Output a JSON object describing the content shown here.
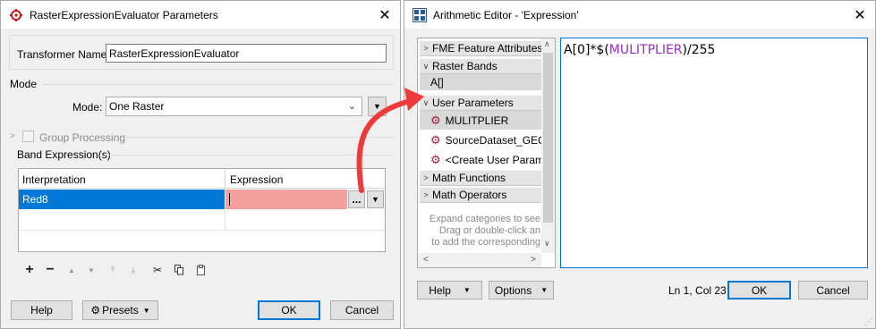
{
  "left_dialog": {
    "title": "RasterExpressionEvaluator Parameters",
    "transformer_name_label": "Transformer Name:",
    "transformer_name_value": "RasterExpressionEvaluator",
    "mode_section": "Mode",
    "mode_label": "Mode:",
    "mode_value": "One Raster",
    "group_processing_label": "Group Processing",
    "band_expressions_section": "Band Expression(s)",
    "table": {
      "columns": [
        "Interpretation",
        "Expression"
      ],
      "rows": [
        {
          "interpretation": "Red8",
          "expression": ""
        }
      ]
    },
    "ellipsis_label": "...",
    "buttons": {
      "help": "Help",
      "presets": "Presets",
      "ok": "OK",
      "cancel": "Cancel"
    }
  },
  "right_dialog": {
    "title": "Arithmetic Editor - 'Expression'",
    "categories": {
      "fme_feature_attributes": "FME Feature Attributes",
      "raster_bands": "Raster Bands",
      "raster_band_item": "A[]",
      "user_parameters": "User Parameters",
      "user_param_items": [
        "MULITPLIER",
        "SourceDataset_GEC",
        "<Create User Param"
      ],
      "math_functions": "Math Functions",
      "math_operators": "Math Operators"
    },
    "hint_lines": [
      "Expand categories to see",
      "Drag or double-click an",
      "to add the corresponding"
    ],
    "expression": {
      "prefix": "A[0]*$(",
      "param": "MULITPLIER",
      "suffix": ")/255"
    },
    "status": "Ln 1, Col 23",
    "buttons": {
      "help": "Help",
      "options": "Options",
      "ok": "OK",
      "cancel": "Cancel"
    }
  },
  "colors": {
    "selection_blue": "#0078d7",
    "expression_cell_pink": "#f4a09c",
    "arrow_red": "#ee3a3a",
    "param_purple": "#9b2fbf"
  }
}
